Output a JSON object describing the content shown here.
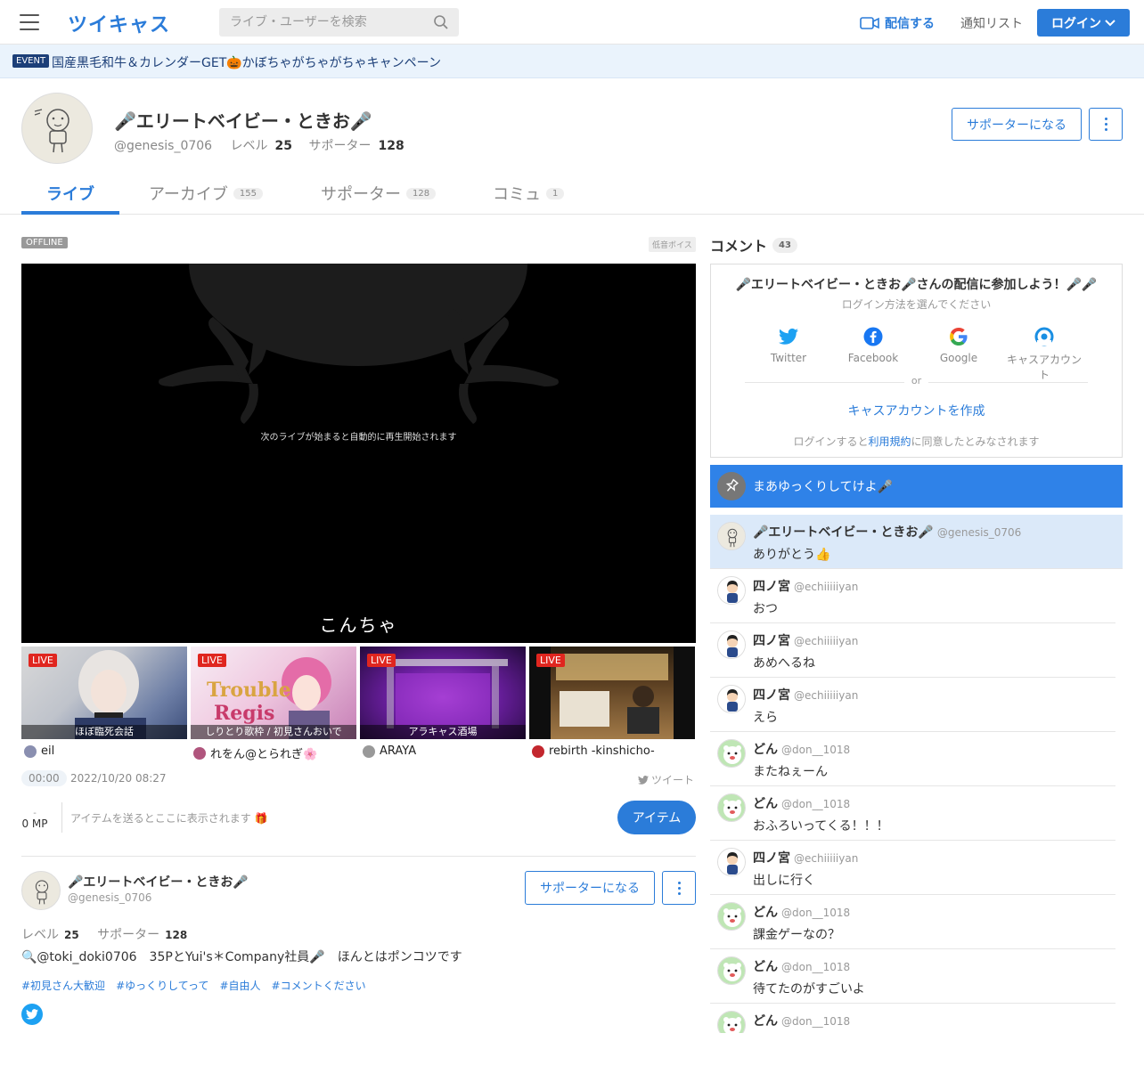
{
  "header": {
    "logo": "ツイキャス",
    "search_placeholder": "ライブ・ユーザーを検索",
    "broadcast_label": "配信する",
    "notify_label": "通知リスト",
    "login_label": "ログイン"
  },
  "event": {
    "badge": "EVENT",
    "text": "国産黒毛和牛＆カレンダーGET🎃かぼちゃがちゃがちゃキャンペーン"
  },
  "profile": {
    "name": "🎤エリートベイビー・ときお🎤",
    "user_id": "@genesis_0706",
    "level_label": "レベル",
    "level": "25",
    "supporter_label": "サポーター",
    "supporters": "128",
    "support_button": "サポーターになる"
  },
  "tabs": [
    {
      "label": "ライブ",
      "count": ""
    },
    {
      "label": "アーカイブ",
      "count": "155"
    },
    {
      "label": "サポーター",
      "count": "128"
    },
    {
      "label": "コミュ",
      "count": "1"
    }
  ],
  "player": {
    "status": "OFFLINE",
    "category": "低音ボイス",
    "message": "次のライブが始まると自動的に再生開始されます",
    "caption": "こんちゃ"
  },
  "live_cards": [
    {
      "badge": "LIVE",
      "title": "ほぼ臨死会話",
      "owner": "eil"
    },
    {
      "badge": "LIVE",
      "title": "しりとり歌枠 / 初見さんおいで",
      "owner": "れをん@とられぎ🌸"
    },
    {
      "badge": "LIVE",
      "title": "アラキャス酒場",
      "owner": "ARAYA"
    },
    {
      "badge": "LIVE",
      "title": "",
      "owner": "rebirth -kinshicho-"
    }
  ],
  "meta": {
    "time": "00:00",
    "date": "2022/10/20 08:27",
    "tweet_label": "ツイート",
    "mp_dash": "-",
    "mp": "0 MP",
    "item_placeholder": "アイテムを送るとここに表示されます 🎁",
    "item_button": "アイテム"
  },
  "user_card": {
    "name": "🎤エリートベイビー・ときお🎤",
    "user_id": "@genesis_0706",
    "support_button": "サポーターになる",
    "level_label": "レベル",
    "level": "25",
    "supporter_label": "サポーター",
    "supporters": "128",
    "bio": "🔍@toki_doki0706　35PとYui's＊Company社員🎤　ほんとはポンコツです",
    "tags": [
      "#初見さん大歓迎",
      "#ゆっくりしてって",
      "#自由人",
      "#コメントください"
    ]
  },
  "comments_panel": {
    "title": "コメント",
    "count": "43",
    "login_title": "🎤エリートベイビー・ときお🎤さんの配信に参加しよう！🎤🎤",
    "login_sub": "ログイン方法を選んでください",
    "options": [
      "Twitter",
      "Facebook",
      "Google",
      "キャスアカウント"
    ],
    "or": "or",
    "create_account": "キャスアカウントを作成",
    "terms_before": "ログインすると",
    "terms_link": "利用規約",
    "terms_after": "に同意したとみなされます",
    "pinned": "まあゆっくりしてけよ🎤",
    "colors": {
      "accent": "#2b7cd9",
      "pinned_bg": "#2f82e8",
      "highlight_bg": "#dbe9f9",
      "live_red": "#e0261f"
    }
  },
  "comments": [
    {
      "name": "🎤エリートベイビー・ときお🎤",
      "id": "@genesis_0706",
      "text": "ありがとう👍",
      "avatar": "owner"
    },
    {
      "name": "四ノ宮",
      "id": "@echiiiiiyan",
      "text": "おつ",
      "avatar": "shinomiya"
    },
    {
      "name": "四ノ宮",
      "id": "@echiiiiiyan",
      "text": "あめへるね",
      "avatar": "shinomiya"
    },
    {
      "name": "四ノ宮",
      "id": "@echiiiiiyan",
      "text": "えら",
      "avatar": "shinomiya"
    },
    {
      "name": "どん",
      "id": "@don__1018",
      "text": "またねぇーん",
      "avatar": "don"
    },
    {
      "name": "どん",
      "id": "@don__1018",
      "text": "おふろいってくる！！！",
      "avatar": "don"
    },
    {
      "name": "四ノ宮",
      "id": "@echiiiiiyan",
      "text": "出しに行く",
      "avatar": "shinomiya"
    },
    {
      "name": "どん",
      "id": "@don__1018",
      "text": "課金ゲーなの？",
      "avatar": "don"
    },
    {
      "name": "どん",
      "id": "@don__1018",
      "text": "待てたのがすごいよ",
      "avatar": "don"
    },
    {
      "name": "どん",
      "id": "@don__1018",
      "text": "",
      "avatar": "don"
    }
  ]
}
